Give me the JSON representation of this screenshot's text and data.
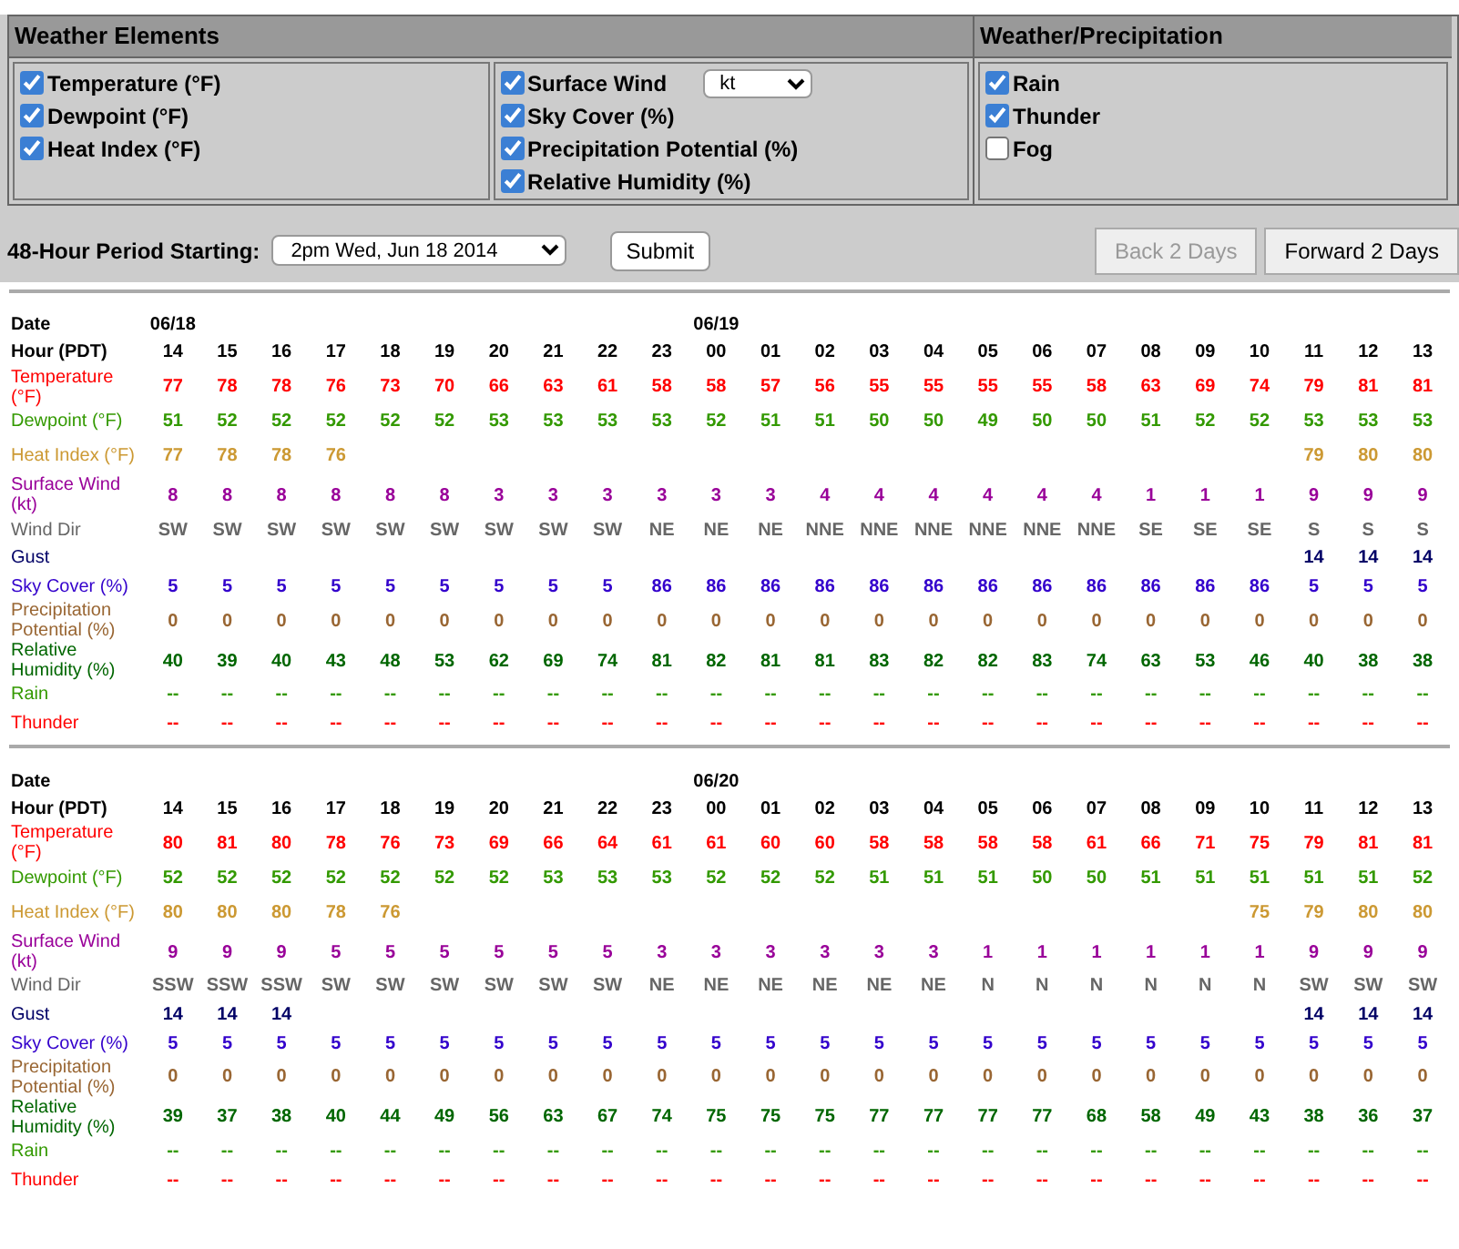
{
  "menu": {
    "sections": [
      {
        "title": "Weather Elements",
        "groups": [
          [
            {
              "label": "Temperature (°F)",
              "checked": true
            },
            {
              "label": "Dewpoint (°F)",
              "checked": true
            },
            {
              "label": "Heat Index (°F)",
              "checked": true
            }
          ],
          [
            {
              "label": "Surface Wind",
              "checked": true,
              "unit": "kt"
            },
            {
              "label": "Sky Cover (%)",
              "checked": true
            },
            {
              "label": "Precipitation Potential (%)",
              "checked": true
            },
            {
              "label": "Relative Humidity (%)",
              "checked": true
            }
          ]
        ]
      },
      {
        "title": "Weather/Precipitation",
        "groups": [
          [
            {
              "label": "Rain",
              "checked": true
            },
            {
              "label": "Thunder",
              "checked": true
            },
            {
              "label": "Fog",
              "checked": false
            }
          ]
        ]
      }
    ],
    "period": {
      "label": "48-Hour Period Starting:",
      "value": "2pm Wed, Jun 18 2014",
      "submit": "Submit"
    },
    "nav_buttons": [
      {
        "label": "Back 2 Days",
        "disabled": true
      },
      {
        "label": "Forward 2 Days",
        "disabled": false
      }
    ]
  },
  "tables": [
    {
      "rows": [
        {
          "label": "Date",
          "kind": "date"
        },
        {
          "label": "Hour (PDT)",
          "kind": "hour"
        },
        {
          "label": "Temperature (°F)",
          "kind": "temperature",
          "color": "#ff0000"
        },
        {
          "label": "Dewpoint (°F)",
          "kind": "dewpoint",
          "color": "#339900"
        },
        {
          "label": "Heat Index (°F)",
          "kind": "heatindex",
          "color": "#cc9933"
        },
        {
          "label": "Surface Wind (kt)",
          "kind": "wind",
          "color": "#990099"
        },
        {
          "label": "Wind Dir",
          "kind": "winddir",
          "color": "#666666"
        },
        {
          "label": "Gust",
          "kind": "gust",
          "color": "#000066"
        },
        {
          "label": "Sky Cover (%)",
          "kind": "sky",
          "color": "#3300cc"
        },
        {
          "label": "Precipitation Potential (%)",
          "kind": "precip",
          "color": "#996633"
        },
        {
          "label": "Relative Humidity (%)",
          "kind": "humidity",
          "color": "#006600"
        },
        {
          "label": "Rain",
          "kind": "rain",
          "color": "#339900"
        },
        {
          "label": "Thunder",
          "kind": "thunder",
          "color": "#ff0000"
        }
      ],
      "columns": [
        {
          "date": "06/18",
          "hour": "14",
          "temperature": "77",
          "dewpoint": "51",
          "heatindex": "77",
          "wind": "8",
          "winddir": "SW",
          "sky": "5",
          "precip": "0",
          "humidity": "40",
          "rain": "--",
          "thunder": "--"
        },
        {
          "hour": "15",
          "temperature": "78",
          "dewpoint": "52",
          "heatindex": "78",
          "wind": "8",
          "winddir": "SW",
          "sky": "5",
          "precip": "0",
          "humidity": "39",
          "rain": "--",
          "thunder": "--"
        },
        {
          "hour": "16",
          "temperature": "78",
          "dewpoint": "52",
          "heatindex": "78",
          "wind": "8",
          "winddir": "SW",
          "sky": "5",
          "precip": "0",
          "humidity": "40",
          "rain": "--",
          "thunder": "--"
        },
        {
          "hour": "17",
          "temperature": "76",
          "dewpoint": "52",
          "heatindex": "76",
          "wind": "8",
          "winddir": "SW",
          "sky": "5",
          "precip": "0",
          "humidity": "43",
          "rain": "--",
          "thunder": "--"
        },
        {
          "hour": "18",
          "temperature": "73",
          "dewpoint": "52",
          "wind": "8",
          "winddir": "SW",
          "sky": "5",
          "precip": "0",
          "humidity": "48",
          "rain": "--",
          "thunder": "--"
        },
        {
          "hour": "19",
          "temperature": "70",
          "dewpoint": "52",
          "wind": "8",
          "winddir": "SW",
          "sky": "5",
          "precip": "0",
          "humidity": "53",
          "rain": "--",
          "thunder": "--"
        },
        {
          "hour": "20",
          "temperature": "66",
          "dewpoint": "53",
          "wind": "3",
          "winddir": "SW",
          "sky": "5",
          "precip": "0",
          "humidity": "62",
          "rain": "--",
          "thunder": "--"
        },
        {
          "hour": "21",
          "temperature": "63",
          "dewpoint": "53",
          "wind": "3",
          "winddir": "SW",
          "sky": "5",
          "precip": "0",
          "humidity": "69",
          "rain": "--",
          "thunder": "--"
        },
        {
          "hour": "22",
          "temperature": "61",
          "dewpoint": "53",
          "wind": "3",
          "winddir": "SW",
          "sky": "5",
          "precip": "0",
          "humidity": "74",
          "rain": "--",
          "thunder": "--"
        },
        {
          "hour": "23",
          "temperature": "58",
          "dewpoint": "53",
          "wind": "3",
          "winddir": "NE",
          "sky": "86",
          "precip": "0",
          "humidity": "81",
          "rain": "--",
          "thunder": "--"
        },
        {
          "date": "06/19",
          "hour": "00",
          "temperature": "58",
          "dewpoint": "52",
          "wind": "3",
          "winddir": "NE",
          "sky": "86",
          "precip": "0",
          "humidity": "82",
          "rain": "--",
          "thunder": "--"
        },
        {
          "hour": "01",
          "temperature": "57",
          "dewpoint": "51",
          "wind": "3",
          "winddir": "NE",
          "sky": "86",
          "precip": "0",
          "humidity": "81",
          "rain": "--",
          "thunder": "--"
        },
        {
          "hour": "02",
          "temperature": "56",
          "dewpoint": "51",
          "wind": "4",
          "winddir": "NNE",
          "sky": "86",
          "precip": "0",
          "humidity": "81",
          "rain": "--",
          "thunder": "--"
        },
        {
          "hour": "03",
          "temperature": "55",
          "dewpoint": "50",
          "wind": "4",
          "winddir": "NNE",
          "sky": "86",
          "precip": "0",
          "humidity": "83",
          "rain": "--",
          "thunder": "--"
        },
        {
          "hour": "04",
          "temperature": "55",
          "dewpoint": "50",
          "wind": "4",
          "winddir": "NNE",
          "sky": "86",
          "precip": "0",
          "humidity": "82",
          "rain": "--",
          "thunder": "--"
        },
        {
          "hour": "05",
          "temperature": "55",
          "dewpoint": "49",
          "wind": "4",
          "winddir": "NNE",
          "sky": "86",
          "precip": "0",
          "humidity": "82",
          "rain": "--",
          "thunder": "--"
        },
        {
          "hour": "06",
          "temperature": "55",
          "dewpoint": "50",
          "wind": "4",
          "winddir": "NNE",
          "sky": "86",
          "precip": "0",
          "humidity": "83",
          "rain": "--",
          "thunder": "--"
        },
        {
          "hour": "07",
          "temperature": "58",
          "dewpoint": "50",
          "wind": "4",
          "winddir": "NNE",
          "sky": "86",
          "precip": "0",
          "humidity": "74",
          "rain": "--",
          "thunder": "--"
        },
        {
          "hour": "08",
          "temperature": "63",
          "dewpoint": "51",
          "wind": "1",
          "winddir": "SE",
          "sky": "86",
          "precip": "0",
          "humidity": "63",
          "rain": "--",
          "thunder": "--"
        },
        {
          "hour": "09",
          "temperature": "69",
          "dewpoint": "52",
          "wind": "1",
          "winddir": "SE",
          "sky": "86",
          "precip": "0",
          "humidity": "53",
          "rain": "--",
          "thunder": "--"
        },
        {
          "hour": "10",
          "temperature": "74",
          "dewpoint": "52",
          "wind": "1",
          "winddir": "SE",
          "sky": "86",
          "precip": "0",
          "humidity": "46",
          "rain": "--",
          "thunder": "--"
        },
        {
          "hour": "11",
          "temperature": "79",
          "dewpoint": "53",
          "heatindex": "79",
          "wind": "9",
          "winddir": "S",
          "gust": "14",
          "sky": "5",
          "precip": "0",
          "humidity": "40",
          "rain": "--",
          "thunder": "--"
        },
        {
          "hour": "12",
          "temperature": "81",
          "dewpoint": "53",
          "heatindex": "80",
          "wind": "9",
          "winddir": "S",
          "gust": "14",
          "sky": "5",
          "precip": "0",
          "humidity": "38",
          "rain": "--",
          "thunder": "--"
        },
        {
          "hour": "13",
          "temperature": "81",
          "dewpoint": "53",
          "heatindex": "80",
          "wind": "9",
          "winddir": "S",
          "gust": "14",
          "sky": "5",
          "precip": "0",
          "humidity": "38",
          "rain": "--",
          "thunder": "--"
        }
      ]
    },
    {
      "rows": [
        {
          "label": "Date",
          "kind": "date"
        },
        {
          "label": "Hour (PDT)",
          "kind": "hour"
        },
        {
          "label": "Temperature (°F)",
          "kind": "temperature",
          "color": "#ff0000"
        },
        {
          "label": "Dewpoint (°F)",
          "kind": "dewpoint",
          "color": "#339900"
        },
        {
          "label": "Heat Index (°F)",
          "kind": "heatindex",
          "color": "#cc9933"
        },
        {
          "label": "Surface Wind (kt)",
          "kind": "wind",
          "color": "#990099"
        },
        {
          "label": "Wind Dir",
          "kind": "winddir",
          "color": "#666666"
        },
        {
          "label": "Gust",
          "kind": "gust",
          "color": "#000066"
        },
        {
          "label": "Sky Cover (%)",
          "kind": "sky",
          "color": "#3300cc"
        },
        {
          "label": "Precipitation Potential (%)",
          "kind": "precip",
          "color": "#996633"
        },
        {
          "label": "Relative Humidity (%)",
          "kind": "humidity",
          "color": "#006600"
        },
        {
          "label": "Rain",
          "kind": "rain",
          "color": "#339900"
        },
        {
          "label": "Thunder",
          "kind": "thunder",
          "color": "#ff0000"
        }
      ],
      "columns": [
        {
          "hour": "14",
          "temperature": "80",
          "dewpoint": "52",
          "heatindex": "80",
          "wind": "9",
          "winddir": "SSW",
          "gust": "14",
          "sky": "5",
          "precip": "0",
          "humidity": "39",
          "rain": "--",
          "thunder": "--"
        },
        {
          "hour": "15",
          "temperature": "81",
          "dewpoint": "52",
          "heatindex": "80",
          "wind": "9",
          "winddir": "SSW",
          "gust": "14",
          "sky": "5",
          "precip": "0",
          "humidity": "37",
          "rain": "--",
          "thunder": "--"
        },
        {
          "hour": "16",
          "temperature": "80",
          "dewpoint": "52",
          "heatindex": "80",
          "wind": "9",
          "winddir": "SSW",
          "gust": "14",
          "sky": "5",
          "precip": "0",
          "humidity": "38",
          "rain": "--",
          "thunder": "--"
        },
        {
          "hour": "17",
          "temperature": "78",
          "dewpoint": "52",
          "heatindex": "78",
          "wind": "5",
          "winddir": "SW",
          "sky": "5",
          "precip": "0",
          "humidity": "40",
          "rain": "--",
          "thunder": "--"
        },
        {
          "hour": "18",
          "temperature": "76",
          "dewpoint": "52",
          "heatindex": "76",
          "wind": "5",
          "winddir": "SW",
          "sky": "5",
          "precip": "0",
          "humidity": "44",
          "rain": "--",
          "thunder": "--"
        },
        {
          "hour": "19",
          "temperature": "73",
          "dewpoint": "52",
          "wind": "5",
          "winddir": "SW",
          "sky": "5",
          "precip": "0",
          "humidity": "49",
          "rain": "--",
          "thunder": "--"
        },
        {
          "hour": "20",
          "temperature": "69",
          "dewpoint": "52",
          "wind": "5",
          "winddir": "SW",
          "sky": "5",
          "precip": "0",
          "humidity": "56",
          "rain": "--",
          "thunder": "--"
        },
        {
          "hour": "21",
          "temperature": "66",
          "dewpoint": "53",
          "wind": "5",
          "winddir": "SW",
          "sky": "5",
          "precip": "0",
          "humidity": "63",
          "rain": "--",
          "thunder": "--"
        },
        {
          "hour": "22",
          "temperature": "64",
          "dewpoint": "53",
          "wind": "5",
          "winddir": "SW",
          "sky": "5",
          "precip": "0",
          "humidity": "67",
          "rain": "--",
          "thunder": "--"
        },
        {
          "hour": "23",
          "temperature": "61",
          "dewpoint": "53",
          "wind": "3",
          "winddir": "NE",
          "sky": "5",
          "precip": "0",
          "humidity": "74",
          "rain": "--",
          "thunder": "--"
        },
        {
          "date": "06/20",
          "hour": "00",
          "temperature": "61",
          "dewpoint": "52",
          "wind": "3",
          "winddir": "NE",
          "sky": "5",
          "precip": "0",
          "humidity": "75",
          "rain": "--",
          "thunder": "--"
        },
        {
          "hour": "01",
          "temperature": "60",
          "dewpoint": "52",
          "wind": "3",
          "winddir": "NE",
          "sky": "5",
          "precip": "0",
          "humidity": "75",
          "rain": "--",
          "thunder": "--"
        },
        {
          "hour": "02",
          "temperature": "60",
          "dewpoint": "52",
          "wind": "3",
          "winddir": "NE",
          "sky": "5",
          "precip": "0",
          "humidity": "75",
          "rain": "--",
          "thunder": "--"
        },
        {
          "hour": "03",
          "temperature": "58",
          "dewpoint": "51",
          "wind": "3",
          "winddir": "NE",
          "sky": "5",
          "precip": "0",
          "humidity": "77",
          "rain": "--",
          "thunder": "--"
        },
        {
          "hour": "04",
          "temperature": "58",
          "dewpoint": "51",
          "wind": "3",
          "winddir": "NE",
          "sky": "5",
          "precip": "0",
          "humidity": "77",
          "rain": "--",
          "thunder": "--"
        },
        {
          "hour": "05",
          "temperature": "58",
          "dewpoint": "51",
          "wind": "1",
          "winddir": "N",
          "sky": "5",
          "precip": "0",
          "humidity": "77",
          "rain": "--",
          "thunder": "--"
        },
        {
          "hour": "06",
          "temperature": "58",
          "dewpoint": "50",
          "wind": "1",
          "winddir": "N",
          "sky": "5",
          "precip": "0",
          "humidity": "77",
          "rain": "--",
          "thunder": "--"
        },
        {
          "hour": "07",
          "temperature": "61",
          "dewpoint": "50",
          "wind": "1",
          "winddir": "N",
          "sky": "5",
          "precip": "0",
          "humidity": "68",
          "rain": "--",
          "thunder": "--"
        },
        {
          "hour": "08",
          "temperature": "66",
          "dewpoint": "51",
          "wind": "1",
          "winddir": "N",
          "sky": "5",
          "precip": "0",
          "humidity": "58",
          "rain": "--",
          "thunder": "--"
        },
        {
          "hour": "09",
          "temperature": "71",
          "dewpoint": "51",
          "wind": "1",
          "winddir": "N",
          "sky": "5",
          "precip": "0",
          "humidity": "49",
          "rain": "--",
          "thunder": "--"
        },
        {
          "hour": "10",
          "temperature": "75",
          "dewpoint": "51",
          "heatindex": "75",
          "wind": "1",
          "winddir": "N",
          "sky": "5",
          "precip": "0",
          "humidity": "43",
          "rain": "--",
          "thunder": "--"
        },
        {
          "hour": "11",
          "temperature": "79",
          "dewpoint": "51",
          "heatindex": "79",
          "wind": "9",
          "winddir": "SW",
          "gust": "14",
          "sky": "5",
          "precip": "0",
          "humidity": "38",
          "rain": "--",
          "thunder": "--"
        },
        {
          "hour": "12",
          "temperature": "81",
          "dewpoint": "51",
          "heatindex": "80",
          "wind": "9",
          "winddir": "SW",
          "gust": "14",
          "sky": "5",
          "precip": "0",
          "humidity": "36",
          "rain": "--",
          "thunder": "--"
        },
        {
          "hour": "13",
          "temperature": "81",
          "dewpoint": "52",
          "heatindex": "80",
          "wind": "9",
          "winddir": "SW",
          "gust": "14",
          "sky": "5",
          "precip": "0",
          "humidity": "37",
          "rain": "--",
          "thunder": "--"
        }
      ]
    }
  ]
}
